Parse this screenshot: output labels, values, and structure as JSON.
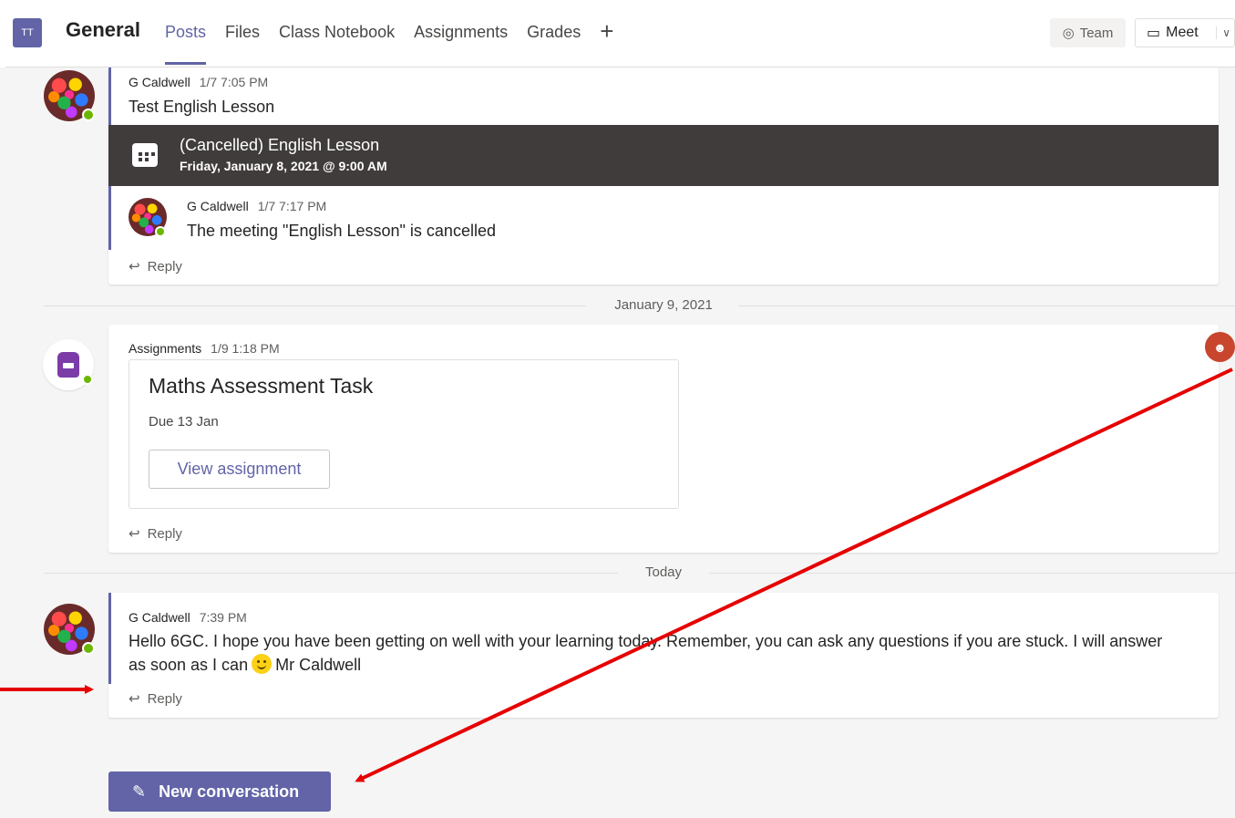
{
  "header": {
    "team_initials": "TT",
    "channel": "General",
    "tabs": [
      "Posts",
      "Files",
      "Class Notebook",
      "Assignments",
      "Grades"
    ],
    "add_tab_icon": "plus-icon",
    "team_button": "Team",
    "meet_button": "Meet"
  },
  "posts": [
    {
      "author": "G Caldwell",
      "time": "1/7 7:05 PM",
      "text": "Test English Lesson",
      "meeting": {
        "title": "(Cancelled) English Lesson",
        "date": "Friday, January 8, 2021 @ 9:00 AM"
      },
      "reply": {
        "author": "G Caldwell",
        "time": "1/7 7:17 PM",
        "text": "The meeting \"English Lesson\" is cancelled"
      },
      "reply_label": "Reply"
    },
    {
      "author": "Assignments",
      "time": "1/9 1:18 PM",
      "assignment": {
        "title": "Maths Assessment Task",
        "due": "Due 13 Jan",
        "button": "View assignment"
      },
      "reply_label": "Reply"
    },
    {
      "author": "G Caldwell",
      "time": "7:39 PM",
      "text_part1": "Hello 6GC. I hope you have been getting on well with your learning today. Remember, you can ask any questions if you are stuck. I will answer",
      "text_part2a": "as soon as I can",
      "text_part2b": "Mr Caldwell",
      "reply_label": "Reply"
    }
  ],
  "separators": [
    "January 9, 2021",
    "Today"
  ],
  "new_conversation": "New conversation",
  "colors": {
    "brand": "#6264a7",
    "annotation_arrow": "#e60000",
    "presence": "#6bb700"
  }
}
